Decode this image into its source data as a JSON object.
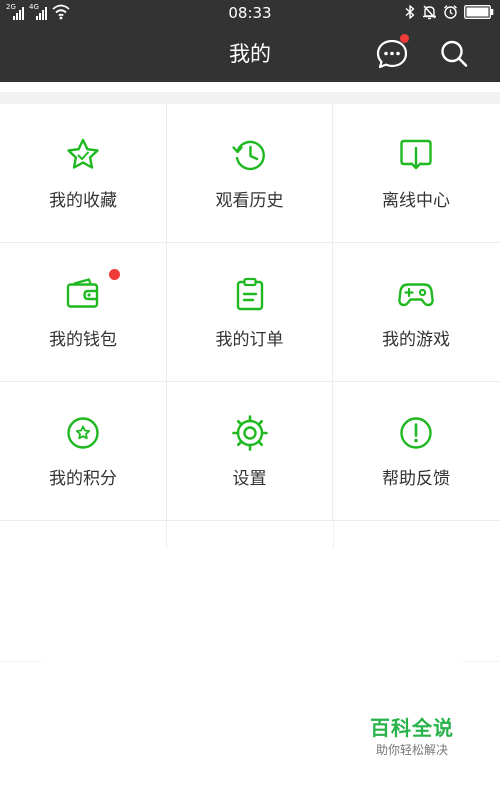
{
  "status_bar": {
    "sim1_label": "2G",
    "sim2_label": "4G",
    "time": "08:33"
  },
  "header": {
    "title": "我的",
    "message_badge": true
  },
  "menu": {
    "items": [
      {
        "label": "我的收藏",
        "icon": "star-icon"
      },
      {
        "label": "观看历史",
        "icon": "history-clock-icon"
      },
      {
        "label": "离线中心",
        "icon": "download-icon"
      },
      {
        "label": "我的钱包",
        "icon": "wallet-icon",
        "badge": true
      },
      {
        "label": "我的订单",
        "icon": "clipboard-icon"
      },
      {
        "label": "我的游戏",
        "icon": "gamepad-icon"
      },
      {
        "label": "我的积分",
        "icon": "points-icon"
      },
      {
        "label": "设置",
        "icon": "settings-gear-icon"
      },
      {
        "label": "帮助反馈",
        "icon": "help-exclamation-icon"
      }
    ]
  },
  "colors": {
    "accent": "#1fb820",
    "header_bg": "#333333",
    "badge": "#f23a3a",
    "watermark": "#28b24a"
  },
  "watermark": {
    "title": "百科全说",
    "subtitle": "助你轻松解决"
  }
}
